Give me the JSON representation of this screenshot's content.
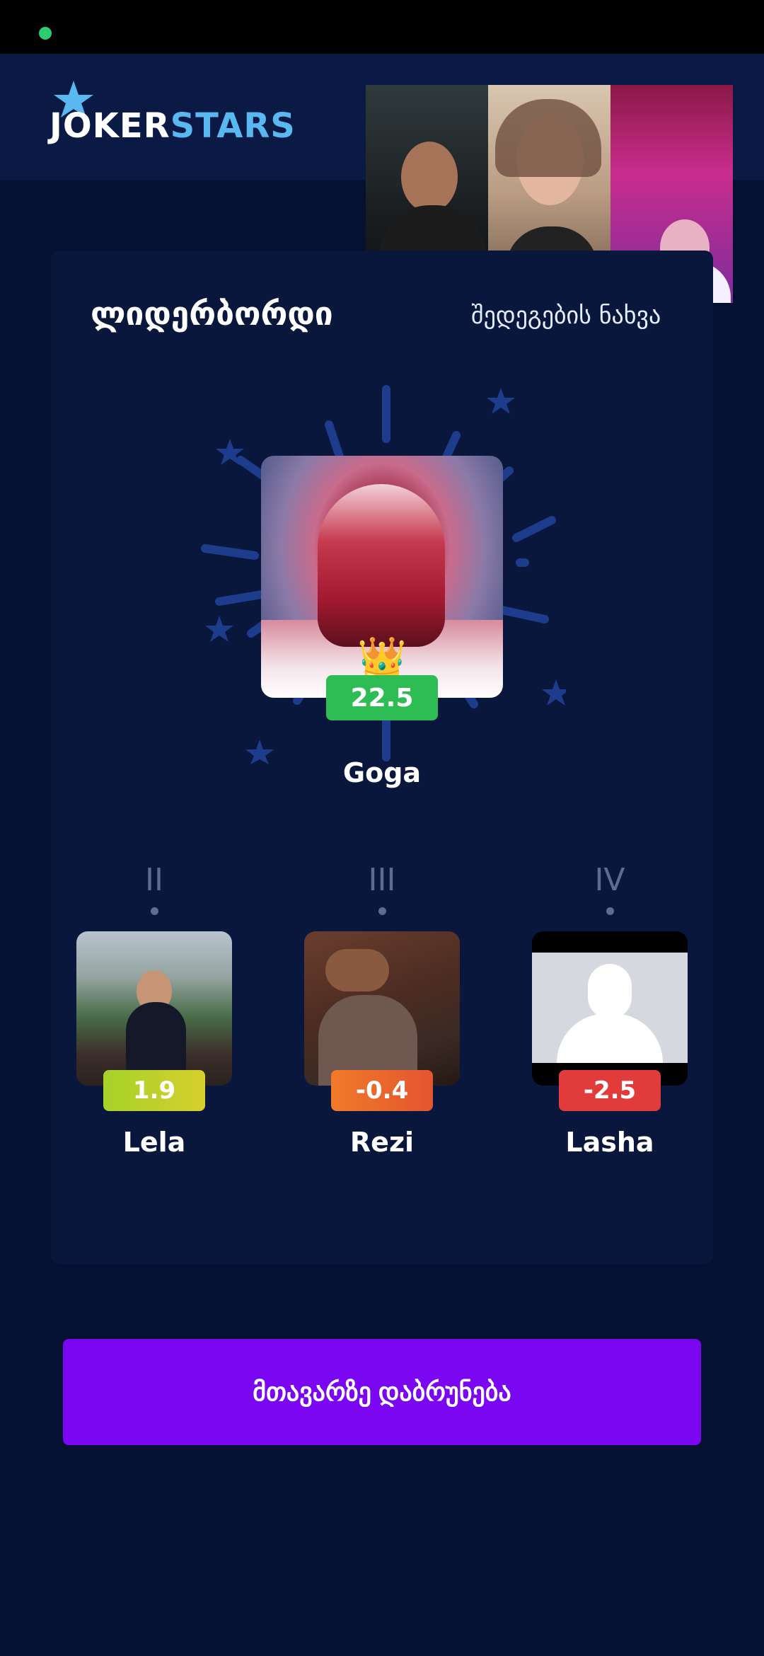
{
  "status_bar": {
    "indicator_color": "#2ecc71"
  },
  "brand": {
    "logo_part1": "JOKER",
    "logo_part2": "STARS",
    "accent": "#5ab8f0"
  },
  "video_call": {
    "participants": [
      {
        "muted": true
      },
      {
        "muted": false
      },
      {
        "muted": false
      }
    ]
  },
  "leaderboard": {
    "title": "ლიდერბორდი",
    "results_link": "შედეგების ნახვა",
    "winner": {
      "name": "Goga",
      "score": "22.5",
      "badge_color": "#2ebd55",
      "icon": "crown-icon"
    },
    "players": [
      {
        "rank": "II",
        "name": "Lela",
        "score": "1.9",
        "badge_color": "#b8d229"
      },
      {
        "rank": "III",
        "name": "Rezi",
        "score": "-0.4",
        "badge_color": "#ee6a2c"
      },
      {
        "rank": "IV",
        "name": "Lasha",
        "score": "-2.5",
        "badge_color": "#e23b3b"
      }
    ]
  },
  "actions": {
    "back_label": "მთავარზე დაბრუნება",
    "button_color": "#7a06f2"
  }
}
